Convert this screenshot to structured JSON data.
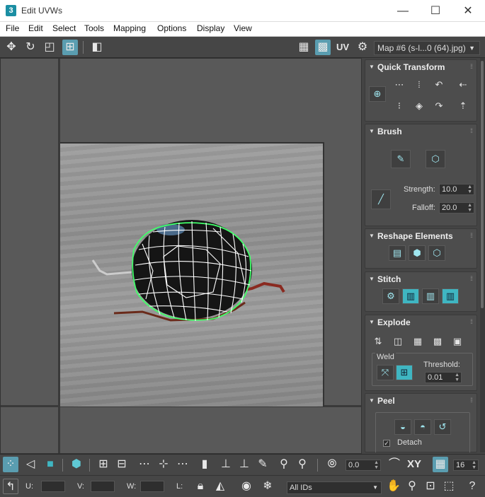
{
  "window": {
    "app_icon": "3",
    "title": "Edit UVWs",
    "minimize": "—",
    "maximize": "☐",
    "close": "✕"
  },
  "menu": [
    "File",
    "Edit",
    "Select",
    "Tools",
    "Mapping",
    "Options",
    "Display",
    "View"
  ],
  "toolbar": {
    "uv_label": "UV",
    "map_select": "Map #6 (s-l...0 (64).jpg)"
  },
  "rollouts": {
    "quick_transform": "Quick Transform",
    "brush": "Brush",
    "strength_label": "Strength:",
    "strength_value": "10.0",
    "falloff_label": "Falloff:",
    "falloff_value": "20.0",
    "reshape": "Reshape Elements",
    "stitch": "Stitch",
    "explode": "Explode",
    "weld_label": "Weld",
    "threshold_label": "Threshold:",
    "threshold_value": "0.01",
    "peel": "Peel",
    "detach_label": "Detach",
    "detach_checked": true
  },
  "bottom": {
    "angle_value": "0.0",
    "xy_label": "XY",
    "grid_value": "16",
    "u_label": "U:",
    "v_label": "V:",
    "w_label": "W:",
    "l_label": "L:",
    "ids_select": "All IDs"
  }
}
